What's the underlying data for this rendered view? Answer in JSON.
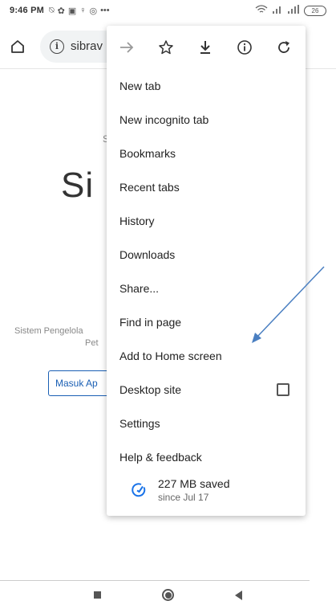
{
  "status_bar": {
    "time": "9:46 PM",
    "left_icons": [
      "notification-icon",
      "settings-icon",
      "storage-icon",
      "location-icon",
      "camera-icon",
      "more-dots"
    ],
    "battery": "26"
  },
  "toolbar": {
    "url_text": "sibrav"
  },
  "page": {
    "small_text": "S",
    "title": "Si",
    "desc_line1": "Sistem Pengelola",
    "desc_line2": "Pet",
    "button_label": "Masuk Ap"
  },
  "menu": {
    "top_icons": [
      "forward-icon",
      "bookmark-star-icon",
      "download-icon",
      "page-info-icon",
      "reload-icon"
    ],
    "items": [
      {
        "label": "New tab"
      },
      {
        "label": "New incognito tab"
      },
      {
        "label": "Bookmarks"
      },
      {
        "label": "Recent tabs"
      },
      {
        "label": "History"
      },
      {
        "label": "Downloads"
      },
      {
        "label": "Share..."
      },
      {
        "label": "Find in page"
      },
      {
        "label": "Add to Home screen"
      },
      {
        "label": "Desktop site"
      },
      {
        "label": "Settings"
      },
      {
        "label": "Help & feedback"
      }
    ],
    "data_saver": {
      "amount": "227 MB saved",
      "since": "since Jul 17"
    }
  },
  "colors": {
    "accent": "#1a73e8",
    "arrow": "#4a7fc1"
  }
}
